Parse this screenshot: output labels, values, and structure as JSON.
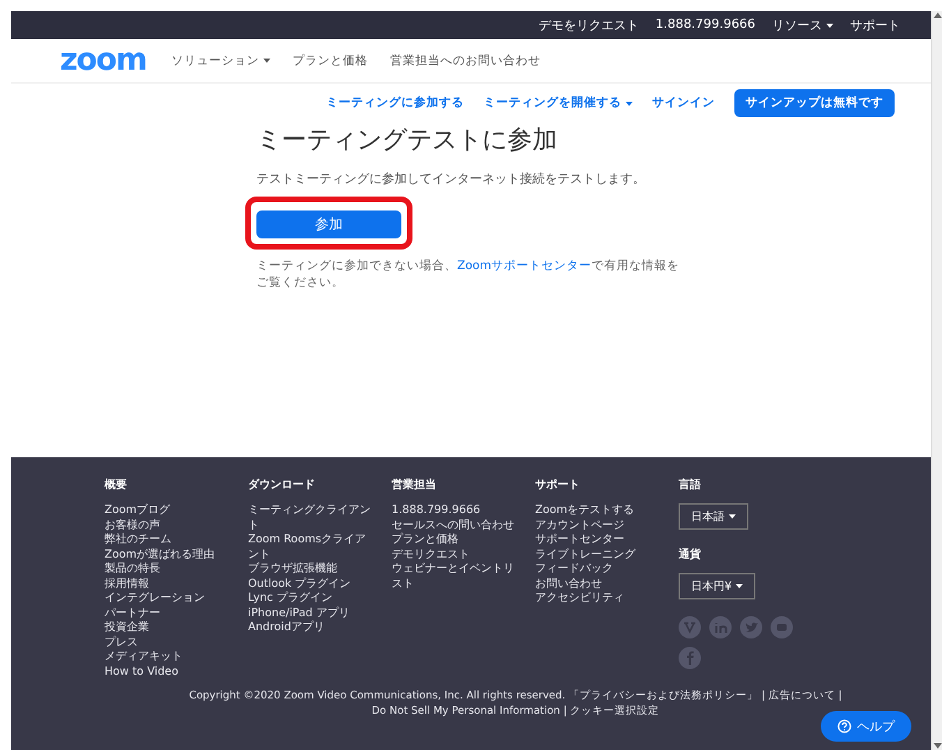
{
  "top_bar": {
    "items": [
      {
        "label": "デモをリクエスト",
        "dropdown": false
      },
      {
        "label": "1.888.799.9666",
        "dropdown": false
      },
      {
        "label": "リソース",
        "dropdown": true
      },
      {
        "label": "サポート",
        "dropdown": false
      }
    ]
  },
  "header": {
    "logo": "zoom",
    "nav": [
      {
        "label": "ソリューション",
        "dropdown": true
      },
      {
        "label": "プランと価格",
        "dropdown": false
      },
      {
        "label": "営業担当へのお問い合わせ",
        "dropdown": false
      }
    ]
  },
  "subnav": {
    "links": [
      {
        "label": "ミーティングに参加する",
        "dropdown": false
      },
      {
        "label": "ミーティングを開催する",
        "dropdown": true
      },
      {
        "label": "サインイン",
        "dropdown": false
      }
    ],
    "signup_button": "サインアップは無料です"
  },
  "main": {
    "title": "ミーティングテストに参加",
    "description": "テストミーティングに参加してインターネット接続をテストします。",
    "join_button": "参加",
    "highlighted": true,
    "help_before": "ミーティングに参加できない場合、",
    "help_link": "Zoomサポートセンター",
    "help_after": "で有用な情報をご覧ください。"
  },
  "footer": {
    "columns": [
      {
        "heading": "概要",
        "links": [
          "Zoomブログ",
          "お客様の声",
          "弊社のチーム",
          "Zoomが選ばれる理由",
          "製品の特長",
          "採用情報",
          "インテグレーション",
          "パートナー",
          "投資企業",
          "プレス",
          "メディアキット",
          "How to Video"
        ]
      },
      {
        "heading": "ダウンロード",
        "links": [
          "ミーティングクライアント",
          "Zoom Roomsクライアント",
          "ブラウザ拡張機能",
          "Outlook プラグイン",
          "Lync プラグイン",
          "iPhone/iPad アプリ",
          "Androidアプリ"
        ]
      },
      {
        "heading": "営業担当",
        "links": [
          "1.888.799.9666",
          "セールスへの問い合わせ",
          "プランと価格",
          "デモリクエスト",
          "ウェビナーとイベントリスト"
        ]
      },
      {
        "heading": "サポート",
        "links": [
          "Zoomをテストする",
          "アカウントページ",
          "サポートセンター",
          "ライブトレーニング",
          "フィードバック",
          "お問い合わせ",
          "アクセシビリティ"
        ]
      }
    ],
    "language": {
      "heading": "言語",
      "value": "日本語"
    },
    "currency": {
      "heading": "通貨",
      "value": "日本円¥"
    },
    "copyright": "Copyright ©2020 Zoom Video Communications, Inc. All rights reserved.",
    "separator": "|",
    "legal_links": [
      "「プライバシーおよび法務ポリシー」",
      "広告について",
      "Do Not Sell My Personal Information",
      "クッキー選択設定"
    ]
  },
  "help_button": "ヘルプ"
}
